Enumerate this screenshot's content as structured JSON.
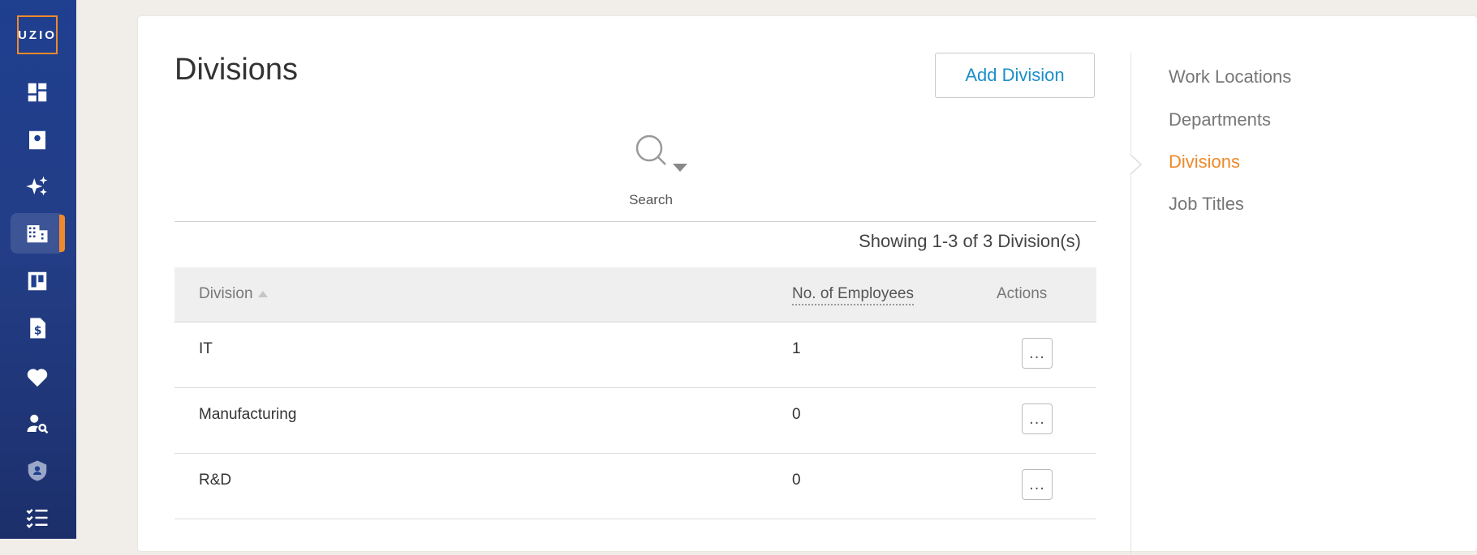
{
  "brand": {
    "logo_text": "UZIO",
    "accent": "#f0892b",
    "nav_bg": "#1f3f8f"
  },
  "sidebar": {
    "items": [
      {
        "icon": "dashboard-icon",
        "active": false
      },
      {
        "icon": "contact-card-icon",
        "active": false
      },
      {
        "icon": "sparkles-icon",
        "active": false
      },
      {
        "icon": "building-icon",
        "active": true
      },
      {
        "icon": "board-icon",
        "active": false
      },
      {
        "icon": "document-dollar-icon",
        "active": false
      },
      {
        "icon": "heart-icon",
        "active": false
      },
      {
        "icon": "user-search-icon",
        "active": false
      },
      {
        "icon": "shield-user-icon",
        "active": false
      },
      {
        "icon": "checklist-icon",
        "active": false
      }
    ]
  },
  "main": {
    "title": "Divisions",
    "add_button": "Add Division",
    "search_label": "Search",
    "showing": "Showing 1-3 of 3 Division(s)",
    "table": {
      "headers": {
        "division": "Division",
        "employees": "No. of Employees",
        "actions": "Actions"
      },
      "rows": [
        {
          "division": "IT",
          "employees": "1",
          "actions": "..."
        },
        {
          "division": "Manufacturing",
          "employees": "0",
          "actions": "..."
        },
        {
          "division": "R&D",
          "employees": "0",
          "actions": "..."
        }
      ]
    }
  },
  "right_nav": {
    "items": [
      {
        "label": "Work Locations",
        "active": false
      },
      {
        "label": "Departments",
        "active": false
      },
      {
        "label": "Divisions",
        "active": true
      },
      {
        "label": "Job Titles",
        "active": false
      }
    ]
  }
}
